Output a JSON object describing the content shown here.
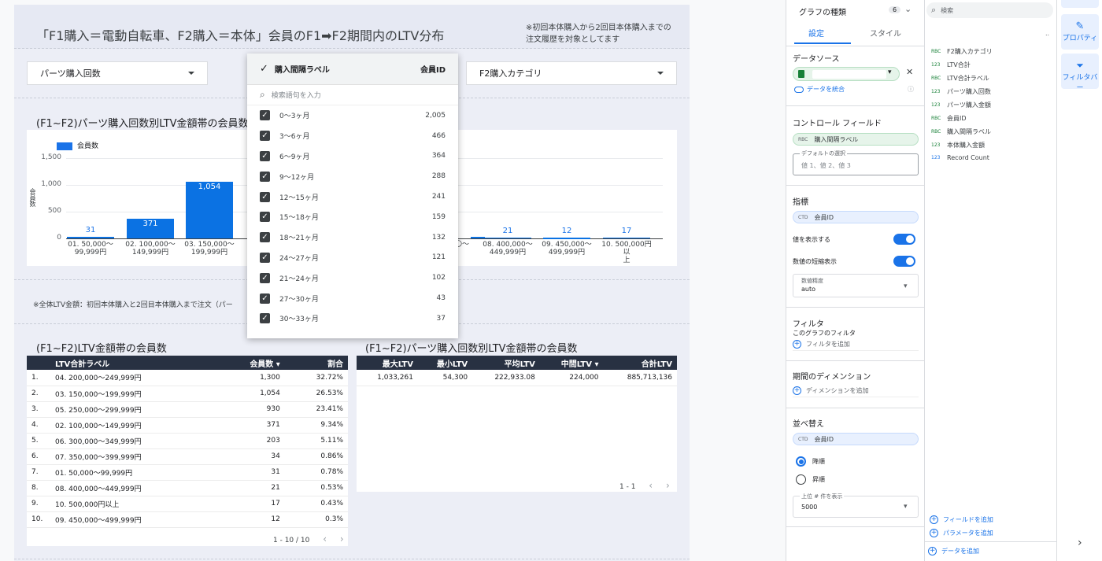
{
  "report": {
    "title": "「F1購入＝電動自転車、F2購入＝本体」会員のF1➡F2期間内のLTV分布",
    "note_line1": "※初回本体購入から2回目本体購入までの",
    "note_line2": "注文履歴を対象としてます",
    "controls": [
      {
        "label": "パーツ購入回数"
      },
      {
        "label": "F2購入カテゴリ"
      }
    ],
    "chart_section_title": "(F1~F2)パーツ購入回数別LTV金額帯の会員数",
    "footnote": "※全体LTV金額：初回本体購入と2回目本体購入まで注文（パー",
    "table1_title": "(F1~F2)LTV金額帯の会員数",
    "table2_title": "(F1~F2)パーツ購入回数別LTV金額帯の会員数"
  },
  "chart_data": {
    "type": "bar",
    "legend": "会員数",
    "ylabel": "会員数",
    "yticks": [
      "0",
      "500",
      "1,000",
      "1,500"
    ],
    "ylim": [
      0,
      1500
    ],
    "bars": [
      {
        "category_line1": "01. 50,000〜",
        "category_line2": "99,999円",
        "value": 31,
        "label": "31"
      },
      {
        "category_line1": "02. 100,000〜",
        "category_line2": "149,999円",
        "value": 371,
        "label": "371"
      },
      {
        "category_line1": "03. 150,000〜",
        "category_line2": "199,999円",
        "value": 1054,
        "label": "1,054"
      },
      {
        "category_line1": "08. 400,000〜",
        "category_line2": "449,999円",
        "value": 21,
        "label": "21"
      },
      {
        "category_line1": "09. 450,000〜",
        "category_line2": "499,999円",
        "value": 12,
        "label": "12"
      },
      {
        "category_line1": "10. 500,000円以",
        "category_line2": "上",
        "value": 17,
        "label": "17"
      }
    ],
    "partial_label": "〇〜"
  },
  "table1": {
    "headers": [
      "LTV合計ラベル",
      "会員数 ▾",
      "割合"
    ],
    "rows": [
      [
        "1.",
        "04. 200,000〜249,999円",
        "1,300",
        "32.72%"
      ],
      [
        "2.",
        "03. 150,000〜199,999円",
        "1,054",
        "26.53%"
      ],
      [
        "3.",
        "05. 250,000〜299,999円",
        "930",
        "23.41%"
      ],
      [
        "4.",
        "02. 100,000〜149,999円",
        "371",
        "9.34%"
      ],
      [
        "5.",
        "06. 300,000〜349,999円",
        "203",
        "5.11%"
      ],
      [
        "6.",
        "07. 350,000〜399,999円",
        "34",
        "0.86%"
      ],
      [
        "7.",
        "01. 50,000〜99,999円",
        "31",
        "0.78%"
      ],
      [
        "8.",
        "08. 400,000〜449,999円",
        "21",
        "0.53%"
      ],
      [
        "9.",
        "10. 500,000円以上",
        "17",
        "0.43%"
      ],
      [
        "10.",
        "09. 450,000〜499,999円",
        "12",
        "0.3%"
      ]
    ],
    "pager": "1 - 10 / 10"
  },
  "table2": {
    "headers": [
      "最大LTV",
      "最小LTV",
      "平均LTV",
      "中間LTV ▾",
      "合計LTV"
    ],
    "row": [
      "1,033,261",
      "54,300",
      "222,933.08",
      "224,000",
      "885,713,136"
    ],
    "pager": "1 - 1"
  },
  "dropdown": {
    "header_label": "購入間隔ラベル",
    "header_metric": "会員ID",
    "search_placeholder": "検索語句を入力",
    "items": [
      {
        "label": "0〜3ヶ月",
        "count": "2,005"
      },
      {
        "label": "3〜6ヶ月",
        "count": "466"
      },
      {
        "label": "6〜9ヶ月",
        "count": "364"
      },
      {
        "label": "9〜12ヶ月",
        "count": "288"
      },
      {
        "label": "12〜15ヶ月",
        "count": "241"
      },
      {
        "label": "15〜18ヶ月",
        "count": "159"
      },
      {
        "label": "18〜21ヶ月",
        "count": "132"
      },
      {
        "label": "24〜27ヶ月",
        "count": "121"
      },
      {
        "label": "21〜24ヶ月",
        "count": "102"
      },
      {
        "label": "27〜30ヶ月",
        "count": "43"
      },
      {
        "label": "30〜33ヶ月",
        "count": "37"
      }
    ]
  },
  "panel": {
    "chart_type": "グラフの種類",
    "badge": "6",
    "tab_setup": "設定",
    "tab_style": "スタイル",
    "datasource": "データソース",
    "blend": "データを統合",
    "control_field": "コントロール フィールド",
    "control_chip": "購入間隔ラベル",
    "control_chip_type": "RBC",
    "default_selection_label": "デフォルトの選択",
    "default_selection_placeholder": "値 1、値 2、値 3",
    "metric": "指標",
    "metric_chip": "会員ID",
    "metric_chip_type": "CTD",
    "show_values": "値を表示する",
    "compact_numbers": "数値の短縮表示",
    "precision_label": "数値精度",
    "precision_value": "auto",
    "filter": "フィルタ",
    "filter_sub": "このグラフのフィルタ",
    "add_filter": "フィルタを追加",
    "period_dim": "期間のディメンション",
    "add_dimension": "ディメンションを追加",
    "sort": "並べ替え",
    "sort_chip": "会員ID",
    "sort_chip_type": "CTD",
    "desc": "降順",
    "asc": "昇順",
    "top_n_label": "上位 # 件を表示",
    "top_n_value": "5000"
  },
  "fields": {
    "search_placeholder": "検索",
    "more": "..",
    "items": [
      {
        "type": "RBC",
        "label": "F2購入カテゴリ"
      },
      {
        "type": "123",
        "label": "LTV合計"
      },
      {
        "type": "RBC",
        "label": "LTV合計ラベル"
      },
      {
        "type": "123",
        "label": "パーツ購入回数"
      },
      {
        "type": "123",
        "label": "パーツ購入金額"
      },
      {
        "type": "RBC",
        "label": "会員ID"
      },
      {
        "type": "RBC",
        "label": "購入間隔ラベル"
      },
      {
        "type": "123",
        "label": "本体購入金額"
      },
      {
        "type": "123",
        "label": "Record Count"
      }
    ],
    "add_field": "フィールドを追加",
    "add_param": "パラメータを追加",
    "add_data": "データを追加"
  },
  "rail": {
    "properties": "プロパティ",
    "filter_bar": "フィルタバー"
  }
}
